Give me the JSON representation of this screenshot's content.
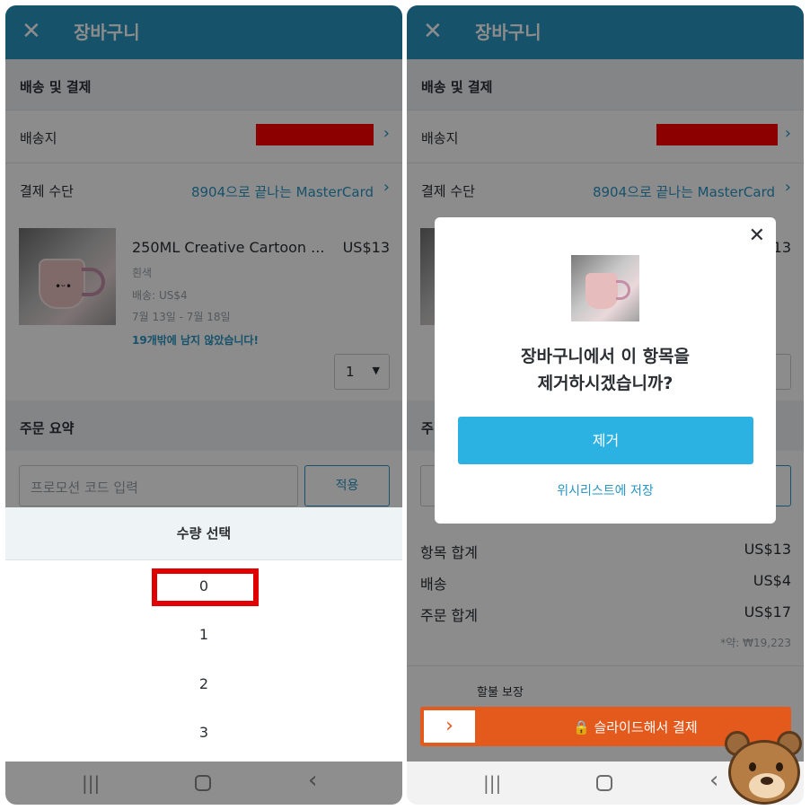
{
  "left": {
    "header": {
      "close_glyph": "✕",
      "title": "장바구니"
    },
    "section_shipping": "배송 및 결제",
    "ship_to_label": "배송지",
    "payment_label": "결제 수단",
    "payment_value": "8904으로 끝나는 MasterCard",
    "chevron": "›",
    "product": {
      "name": "250ML Creative Cartoon ...",
      "price": "US$13",
      "color": "흰색",
      "shipping": "배송: US$4",
      "delivery": "7월 13일 - 7월 18일",
      "stock": "19개밖에 남지 않았습니다!",
      "qty": "1",
      "caret": "▼"
    },
    "section_summary": "주문 요약",
    "promo_placeholder": "프로모션 코드 입력",
    "promo_apply": "적용",
    "picker": {
      "title": "수량 선택",
      "options": [
        "0",
        "1",
        "2",
        "3"
      ]
    }
  },
  "right": {
    "header": {
      "close_glyph": "✕",
      "title": "장바구니"
    },
    "section_shipping": "배송 및 결제",
    "ship_to_label": "배송지",
    "payment_label": "결제 수단",
    "payment_value": "8904으로 끝나는 MasterCard",
    "chevron": "›",
    "product_price": "US$13",
    "summary_initial": "주",
    "dialog": {
      "close": "✕",
      "question_line1": "장바구니에서 이 항목을",
      "question_line2": "제거하시겠습니까?",
      "remove": "제거",
      "wishlist": "위시리스트에 저장"
    },
    "summary": {
      "items_label": "항목 합계",
      "items_value": "US$13",
      "ship_label": "배송",
      "ship_value": "US$4",
      "order_label": "주문 합계",
      "order_value": "US$17",
      "approx": "*약: ₩19,223"
    },
    "protection_label": "할불 보장",
    "slide": {
      "knob": "›",
      "text": "🔒 슬라이드해서 결제"
    }
  },
  "navbar": {
    "recents": "|||",
    "back": "‹"
  },
  "colors": {
    "accent": "#2a95c3",
    "remove_button": "#2cb1e3",
    "pay_bar": "#e4591c",
    "highlight": "#e00000"
  }
}
